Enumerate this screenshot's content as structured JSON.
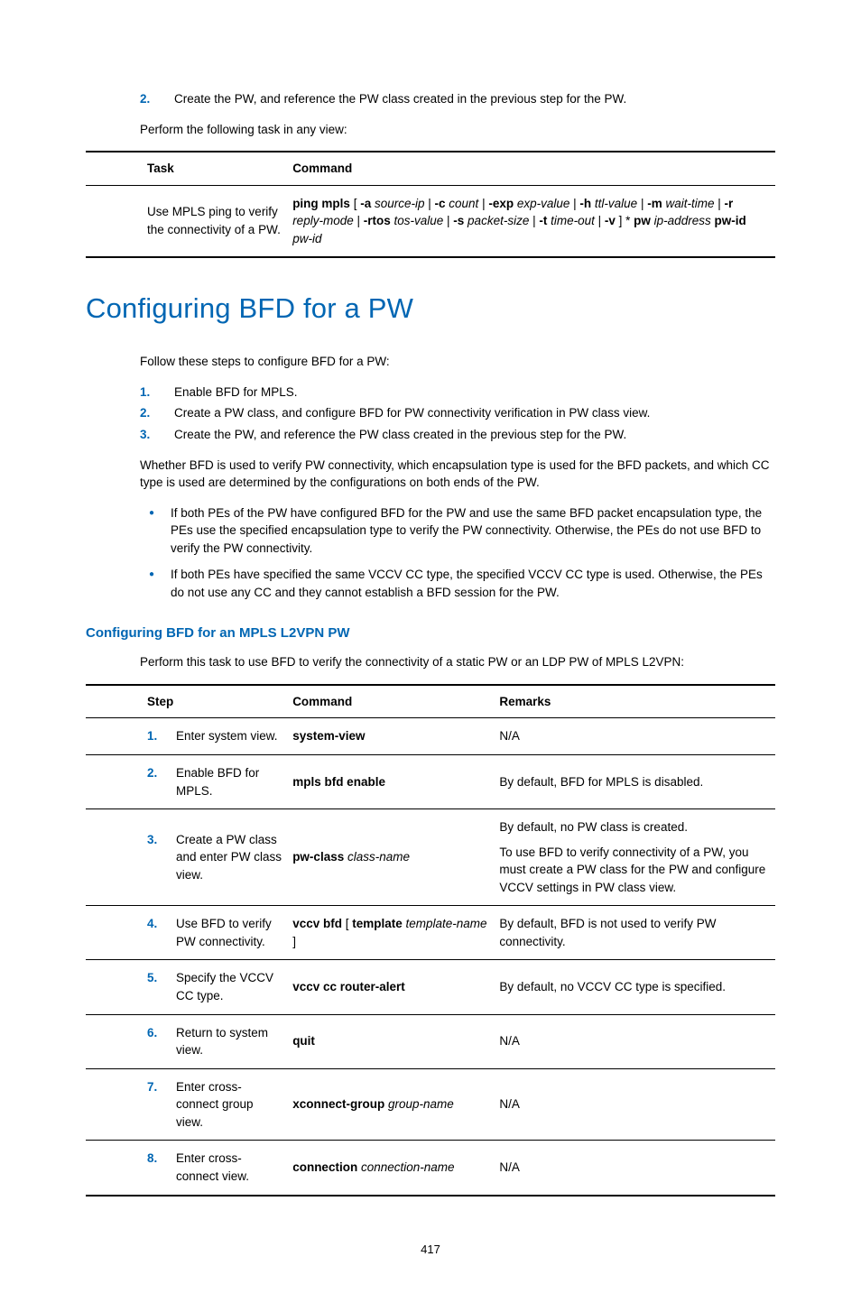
{
  "intro_step2_num": "2.",
  "intro_step2_text": "Create the PW, and reference the PW class created in the previous step for the PW.",
  "intro_task_line": "Perform the following task in any view:",
  "table1": {
    "headers": [
      "Task",
      "Command"
    ],
    "task": "Use MPLS ping to verify the connectivity of a PW.",
    "cmd_parts": {
      "p0": "ping mpls",
      "p1": " [ ",
      "p2": "-a",
      "p3": " source-ip",
      "p4": " | ",
      "p5": "-c",
      "p6": " count",
      "p7": " | ",
      "p8": "-exp",
      "p9": " exp-value",
      "p10": " | ",
      "p11": "-h",
      "p12": " ttl-value",
      "p13": " | ",
      "p14": "-m",
      "p15": " wait-time",
      "p16": " | ",
      "p17": "-r",
      "p18": " reply-mode",
      "p19": " | ",
      "p20": "-rtos",
      "p21": " tos-value",
      "p22": " | ",
      "p23": "-s",
      "p24": " packet-size",
      "p25": " | ",
      "p26": "-t",
      "p27": " time-out",
      "p28": " | ",
      "p29": "-v",
      "p30": " ] * ",
      "p31": "pw",
      "p32": " ip-address ",
      "p33": "pw-id",
      "p34": " pw-id"
    }
  },
  "h1": "Configuring BFD for a PW",
  "bfd_intro": "Follow these steps to configure BFD for a PW:",
  "bfd_steps": [
    {
      "n": "1.",
      "t": "Enable BFD for MPLS."
    },
    {
      "n": "2.",
      "t": "Create a PW class, and configure BFD for PW connectivity verification in PW class view."
    },
    {
      "n": "3.",
      "t": "Create the PW, and reference the PW class created in the previous step for the PW."
    }
  ],
  "bfd_para": "Whether BFD is used to verify PW connectivity, which encapsulation type is used for the BFD packets, and which CC type is used are determined by the configurations on both ends of the PW.",
  "bfd_bullets": [
    "If both PEs of the PW have configured BFD for the PW and use the same BFD packet encapsulation type, the PEs use the specified encapsulation type to verify the PW connectivity. Otherwise, the PEs do not use BFD to verify the PW connectivity.",
    "If both PEs have specified the same VCCV CC type, the specified VCCV CC type is used. Otherwise, the PEs do not use any CC and they cannot establish a BFD session for the PW."
  ],
  "h3": "Configuring BFD for an MPLS L2VPN PW",
  "h3_intro": "Perform this task to use BFD to verify the connectivity of a static PW or an LDP PW of MPLS L2VPN:",
  "table2": {
    "headers": [
      "Step",
      "Command",
      "Remarks"
    ],
    "rows": [
      {
        "num": "1.",
        "step": "Enter system view.",
        "cmd_b": "system-view",
        "cmd_i": "",
        "remarks": "N/A"
      },
      {
        "num": "2.",
        "step": "Enable BFD for MPLS.",
        "cmd_b": "mpls bfd enable",
        "cmd_i": "",
        "remarks": "By default, BFD for MPLS is disabled."
      },
      {
        "num": "3.",
        "step": "Create a PW class and enter PW class view.",
        "cmd_b": "pw-class",
        "cmd_i": " class-name",
        "remarks_line1": "By default, no PW class is created.",
        "remarks_line2": "To use BFD to verify connectivity of a PW, you must create a PW class for the PW and configure VCCV settings in PW class view."
      },
      {
        "num": "4.",
        "step": "Use BFD to verify PW connectivity.",
        "cmd_b1": "vccv bfd",
        "cmd_mid": " [ ",
        "cmd_b2": "template",
        "cmd_i": " template-name",
        "cmd_end": " ]",
        "remarks": "By default, BFD is not used to verify PW connectivity."
      },
      {
        "num": "5.",
        "step": "Specify the VCCV CC type.",
        "cmd_b": "vccv cc router-alert",
        "cmd_i": "",
        "remarks": "By default, no VCCV CC type is specified."
      },
      {
        "num": "6.",
        "step": "Return to system view.",
        "cmd_b": "quit",
        "cmd_i": "",
        "remarks": "N/A"
      },
      {
        "num": "7.",
        "step": "Enter cross-connect group view.",
        "cmd_b": "xconnect-group",
        "cmd_i": " group-name",
        "remarks": "N/A"
      },
      {
        "num": "8.",
        "step": "Enter cross-connect view.",
        "cmd_b": "connection",
        "cmd_i": " connection-name",
        "remarks": "N/A"
      }
    ]
  },
  "page_num": "417"
}
